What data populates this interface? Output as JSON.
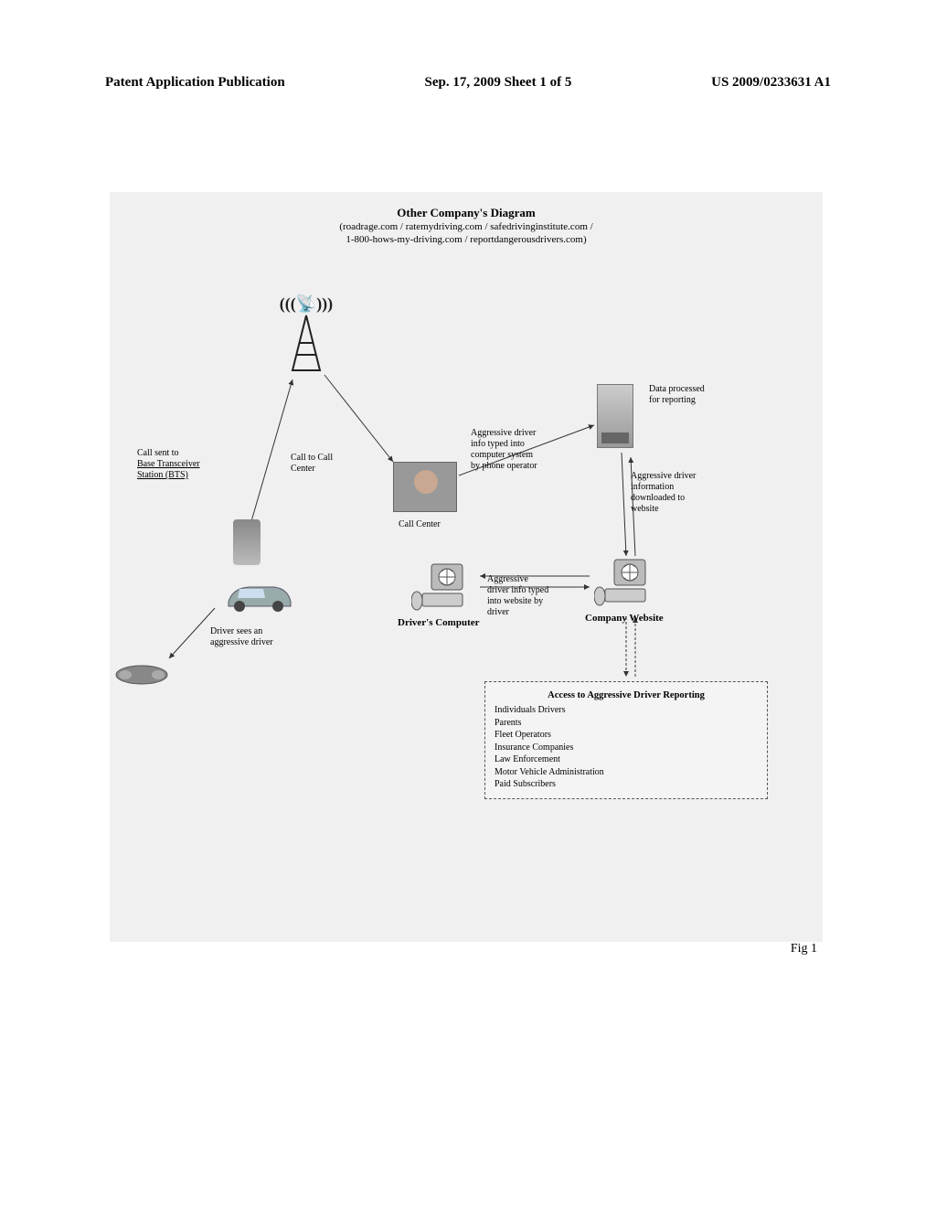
{
  "header": {
    "left": "Patent Application Publication",
    "center": "Sep. 17, 2009  Sheet 1 of 5",
    "right": "US 2009/0233631 A1"
  },
  "diagram": {
    "title_main": "Other Company's Diagram",
    "title_sub1": "(roadrage.com / ratemydriving.com / safedrivinginstitute.com /",
    "title_sub2": "1-800-hows-my-driving.com / reportdangerousdrivers.com)",
    "bts_l1": "Call sent to",
    "bts_l2": "Base Transceiver",
    "bts_l3": "Station (BTS)",
    "call_to_cc_l1": "Call to Call",
    "call_to_cc_l2": "Center",
    "callcenter": "Call Center",
    "agg_typed_l1": "Aggressive driver",
    "agg_typed_l2": "info typed into",
    "agg_typed_l3": "computer system",
    "agg_typed_l4": "by phone operator",
    "dataproc_l1": "Data processed",
    "dataproc_l2": "for reporting",
    "aggdown_l1": "Aggressive driver",
    "aggdown_l2": "information",
    "aggdown_l3": "downloaded to",
    "aggdown_l4": "website",
    "car_l1": "Driver sees an",
    "car_l2": "aggressive driver",
    "driver_comp": "Driver's Computer",
    "aggweb_l1": "Aggressive",
    "aggweb_l2": "driver info typed",
    "aggweb_l3": "into website by",
    "aggweb_l4": "driver",
    "company_site": "Company Website",
    "access": {
      "title": "Access to Aggressive Driver Reporting",
      "items": [
        "Individuals Drivers",
        "Parents",
        "Fleet Operators",
        "Insurance Companies",
        "Law Enforcement",
        "Motor Vehicle Administration",
        "Paid Subscribers"
      ]
    }
  },
  "figure_label": "Fig 1"
}
